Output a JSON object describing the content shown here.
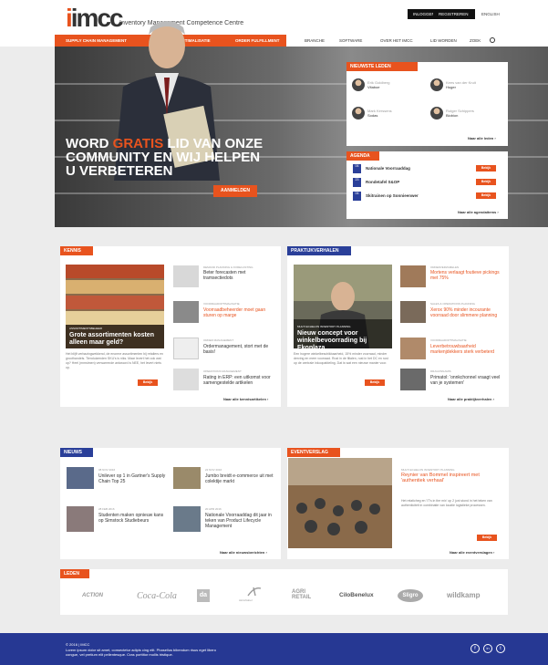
{
  "header": {
    "logo": "imcc",
    "tagline": "Inventory Management Competence Centre",
    "login": "INLOGGEN",
    "register": "REGISTREREN",
    "language": "ENGLISH"
  },
  "nav": {
    "primary": [
      "SUPPLY CHAIN MANAGEMENT",
      "VOORRAADOPTIMALISATIE",
      "ORDER FULFILLMENT"
    ],
    "secondary": [
      "BRANCHE",
      "SOFTWARE",
      "OVER HET IMCC",
      "LID WORDEN",
      "ZOEK"
    ]
  },
  "hero": {
    "line1a": "WORD",
    "line1b": "GRATIS",
    "line1c": "LID VAN ONZE",
    "line2": "COMMUNITY EN WIJ HELPEN",
    "line3": "U VERBETEREN",
    "cta": "AANMELDEN"
  },
  "nieuwste_leden": {
    "title": "NIEUWSTE LEDEN",
    "members": [
      {
        "name": "Erik Goldberg",
        "company": "Vitaboe"
      },
      {
        "name": "Kees van der Kruit",
        "company": "Huger"
      },
      {
        "name": "Mark Kerssens",
        "company": "Sodas"
      },
      {
        "name": "Rutger Schippers",
        "company": "Biobion"
      }
    ],
    "more": "Naar alle leden"
  },
  "agenda": {
    "title": "AGENDA",
    "items": [
      {
        "date": "06",
        "title": "Nationale Voorraaddag",
        "btn": "Bekijk"
      },
      {
        "date": "23",
        "title": "Rondetafel S&OP",
        "btn": "Bekijk"
      },
      {
        "date": "06",
        "title": "Skitrainen op Sonnieenwer",
        "btn": "Bekijk"
      }
    ],
    "more": "Naar alle agendaitems"
  },
  "kennis": {
    "title": "KENNIS",
    "featured": {
      "cat": "ASSORTIMENTSBEHEER",
      "title": "Grote assortimenten kosten alleen maar geld?",
      "body": "Het blijft verbazingwekkend, de enorme assortimenten bij retailers en groothandels. Tienduizenden SKU's is niks. Maar levert het ook wat op? Heel (mmstmen) verwarrende antwoord is NEE, het levert niets op.",
      "btn": "Bekijk"
    },
    "items": [
      {
        "cat": "DEMAND PLANNING & FORECASTING",
        "title": "Beter forecasten met tramsectiedots"
      },
      {
        "cat": "VOORRAADOPTIMALISATIE",
        "title": "Voorraadbeheerder moet gaan sturen op marge"
      },
      {
        "cat": "ORDER MANAGEMENT",
        "title": "Ordermanagement, stort met de basis!"
      },
      {
        "cat": "OPERATIONS MANAGEMENT",
        "title": "Rating in ERP: een uitkomst voor samengestelde artikelen"
      }
    ],
    "more": "Naar alle kennisartikelen"
  },
  "praktijk": {
    "title": "PRAKTIJKVERHALEN",
    "featured": {
      "cat": "MULTI ECHELON INVENTORY PLANNING",
      "title": "Nieuw concept voor winkelbevoorrading bij Ekoplaza",
      "body": "Een hogere winkelbeschikbaarheid, 15% minder voorraad, minder derving en meer voorraad. Rust in de filialen, rust in het DC en rust op de centrale inkoopafdeling. Dat is wat een nieuwe manier voor.",
      "btn": "Bekijk"
    },
    "items": [
      {
        "cat": "ORDERVERZAMELEN",
        "title": "Mortens verlaagt foutieve pickings met 75%"
      },
      {
        "cat": "SALES & OPERATIONS PLANNING",
        "title": "Xerox 90% minder incourante voorraad door slimmere planning"
      },
      {
        "cat": "VOORRAADOPTIMALISATIE",
        "title": "Leverbetrouwbaarheid markenjdekkers sterk verbeterd"
      },
      {
        "cat": "DRAGONNAMIS",
        "title": "Primatol: 'onnkchonnel vraagt veel van je systemen'"
      }
    ],
    "more": "Naar alle praktijkverhalen"
  },
  "nieuws": {
    "title": "NIEUWS",
    "items": [
      {
        "date": "08 NOV 2016",
        "title": "Unilever op 1 in Gartner's Supply Chain Top 25"
      },
      {
        "date": "22 NOV 2016",
        "title": "Jumbo breidt e-commerce uit met colektije markt"
      },
      {
        "date": "28 FEB 2016",
        "title": "Studenten maken opnieuw kans op Simstock Studiebeurs"
      },
      {
        "date": "20 APR 2016",
        "title": "Nationale Voorraaddag dit jaar in teken van Product Lifecycle Management"
      }
    ],
    "more": "Naar alle nieuwsberichten"
  },
  "eventverslag": {
    "title": "EVENTVERSLAG",
    "cat": "MULTI ECHELON INVENTORY PLANNING",
    "headline": "Reynier van Bommel inspireert met 'authentiek verhaal'",
    "body": "Het relaticheg en 'IT's in the mix' op 2 juni stond in het teken van authenticiteit in combinatie van locatie logistieke processen.",
    "btn": "Bekijk",
    "more": "Naar alle eventverslagen"
  },
  "leden": {
    "title": "LEDEN",
    "logos": [
      "ACTION",
      "Coca-Cola",
      "da",
      "AkzoNobel",
      "AGRI RETAIL",
      "CiloBenelux",
      "Sligro",
      "wildkamp"
    ]
  },
  "footer": {
    "copyright": "© 2016 | IMCC",
    "text1": "Lorem ipsum dolor sit amet, consectetur adipis cing elit. Phasellus bibendum risus eget libero",
    "text2": "congue, vel pretium elit pellentesque. Cras porttitor mollis tristique.",
    "social": [
      "f",
      "in",
      "t"
    ]
  },
  "colors": {
    "accent": "#e8531e",
    "brand_blue": "#263893"
  }
}
